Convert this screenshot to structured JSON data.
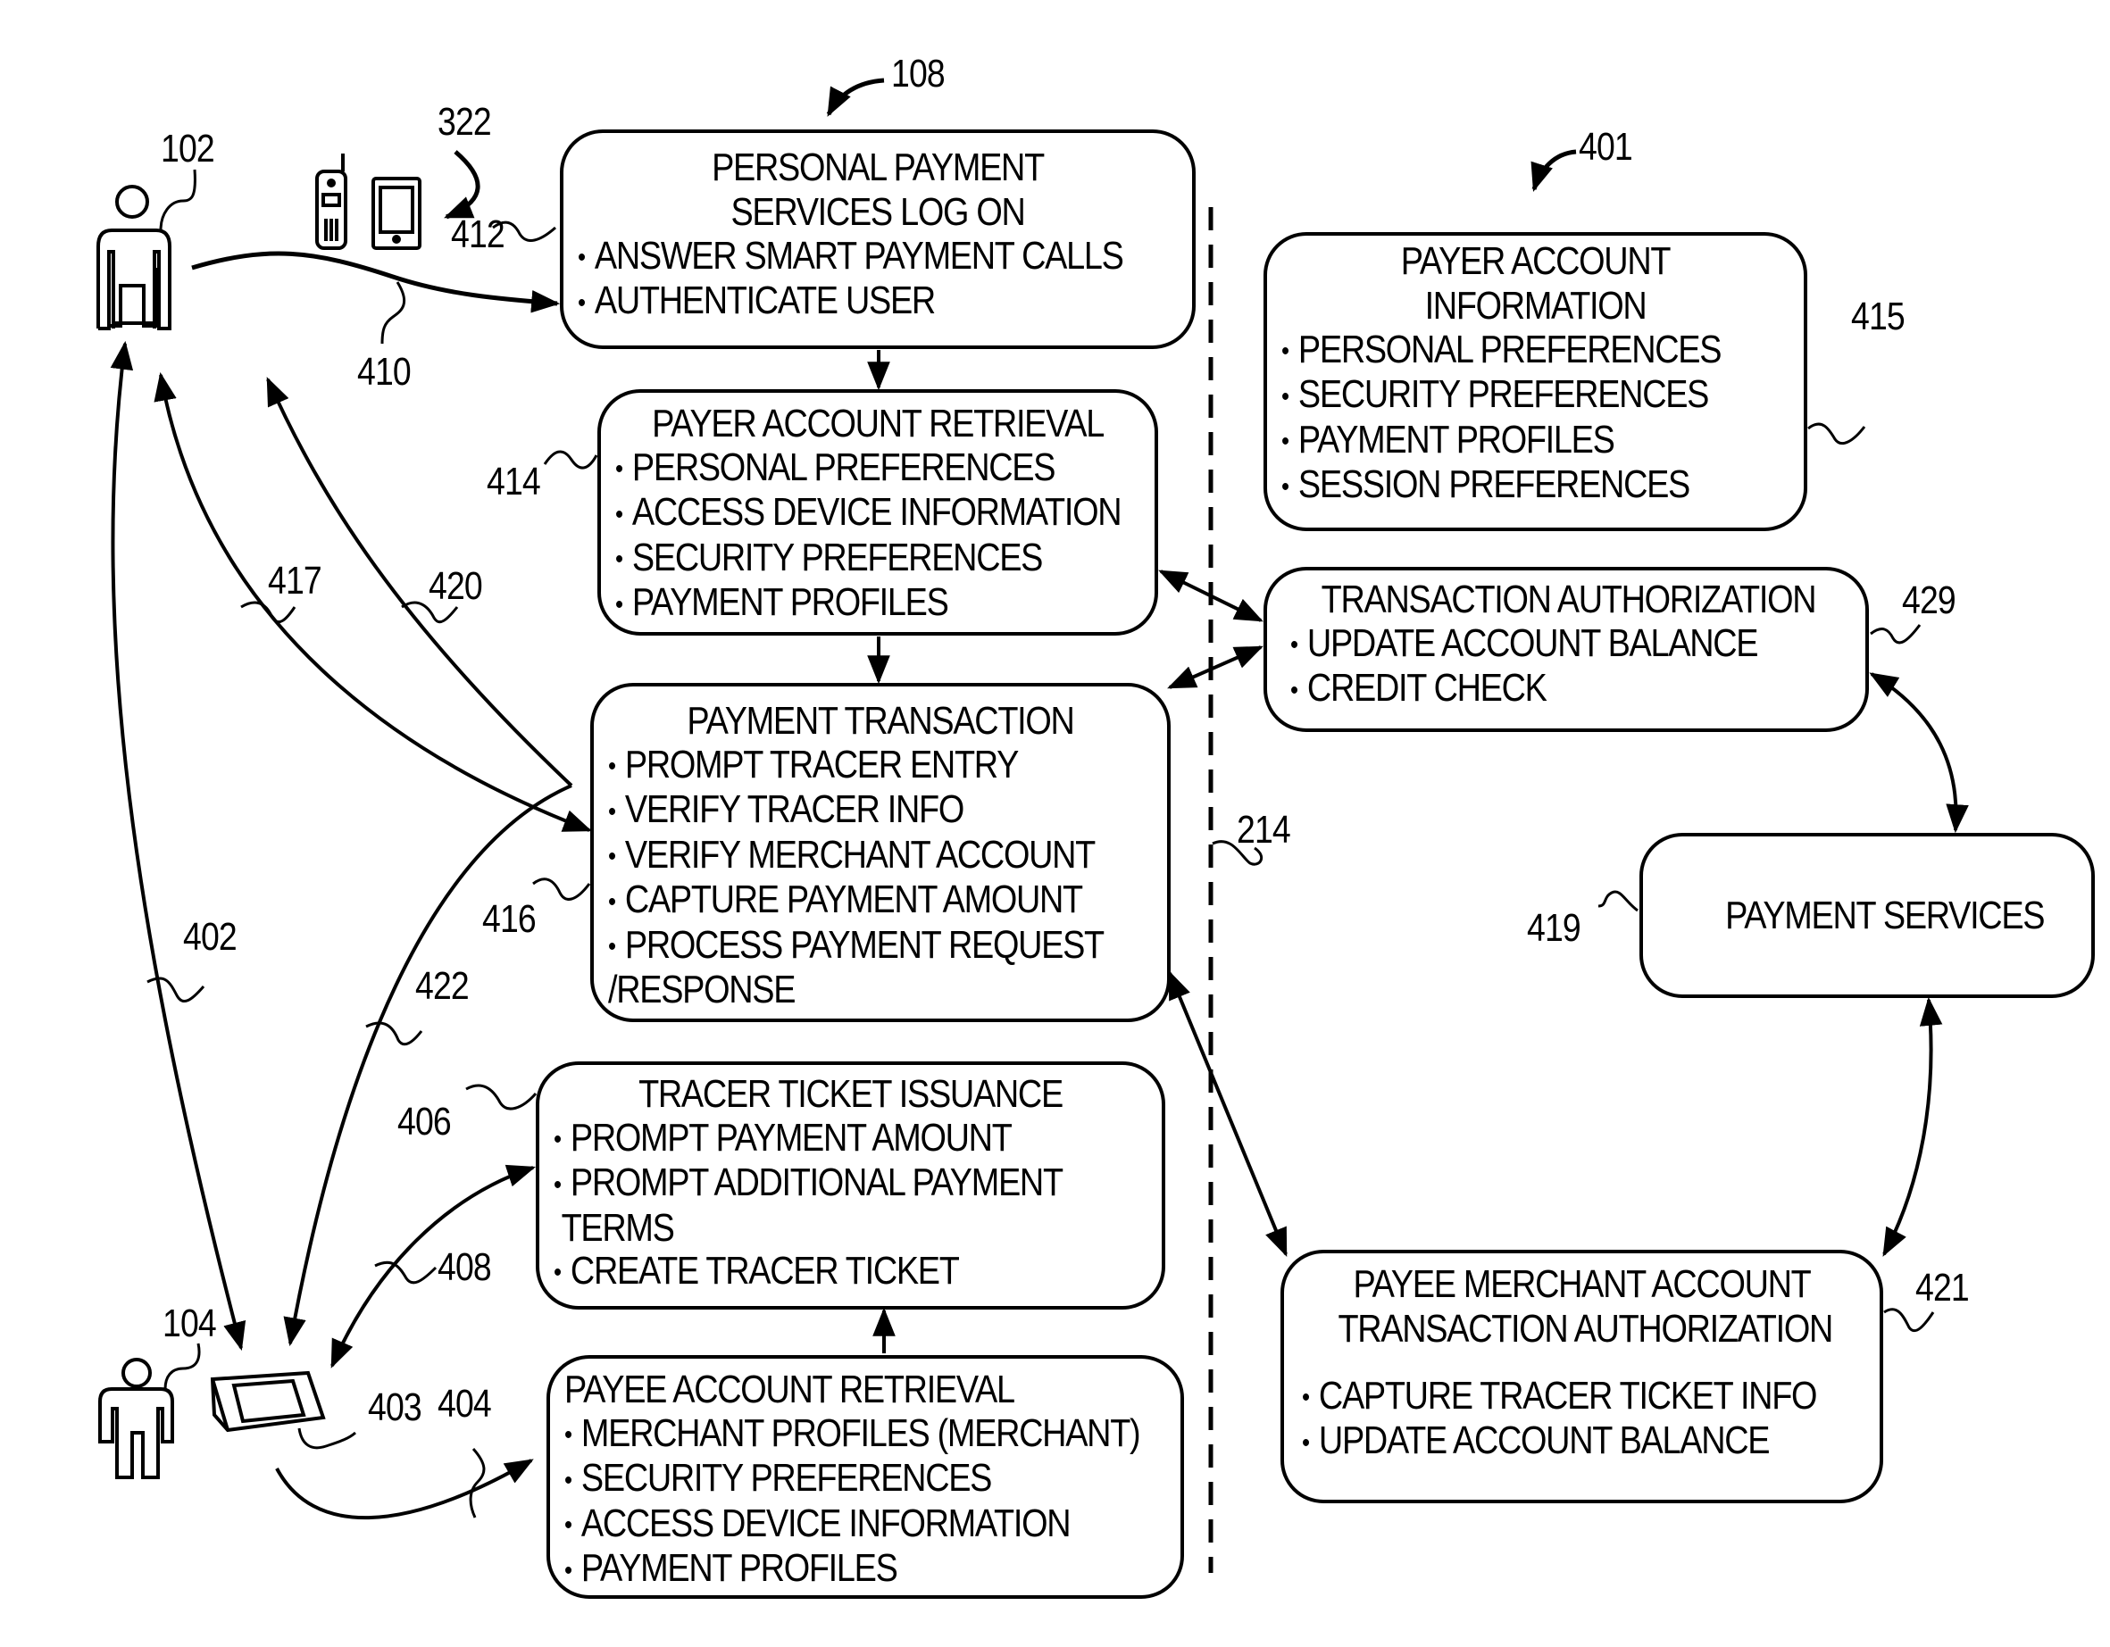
{
  "figure": {
    "references": {
      "system": "108",
      "network": "401",
      "payer_user": "102",
      "payee_user": "104",
      "payer_devices": "322",
      "payee_device": "403",
      "logon_box": "412",
      "payer_retrieval_box": "414",
      "payer_info_box": "415",
      "transaction_box": "416",
      "transaction_auth_box": "429",
      "payment_services_box": "419",
      "merchant_auth_box": "421",
      "tracer_box": "406",
      "payee_retrieval_box": "404",
      "flow_410": "410",
      "flow_417": "417",
      "flow_420": "420",
      "flow_402": "402",
      "flow_422": "422",
      "flow_408": "408",
      "boundary_214": "214"
    },
    "boxes": {
      "logon": {
        "title_lines": [
          "PERSONAL PAYMENT",
          "SERVICES LOG ON"
        ],
        "items": [
          "ANSWER SMART PAYMENT CALLS",
          "AUTHENTICATE USER"
        ]
      },
      "payer_retrieval": {
        "title": "PAYER ACCOUNT RETRIEVAL",
        "items": [
          "PERSONAL PREFERENCES",
          "ACCESS DEVICE INFORMATION",
          "SECURITY PREFERENCES",
          "PAYMENT PROFILES"
        ]
      },
      "transaction": {
        "title": "PAYMENT TRANSACTION",
        "items": [
          "PROMPT TRACER ENTRY",
          "VERIFY TRACER INFO",
          "VERIFY MERCHANT ACCOUNT",
          "CAPTURE PAYMENT AMOUNT",
          "PROCESS PAYMENT REQUEST"
        ],
        "continuation": "/RESPONSE"
      },
      "tracer": {
        "title": "TRACER TICKET ISSUANCE",
        "items": [
          "PROMPT PAYMENT AMOUNT",
          "PROMPT ADDITIONAL PAYMENT"
        ],
        "continuation": "TERMS",
        "last_item": "CREATE TRACER TICKET"
      },
      "payee_retrieval": {
        "title": "PAYEE ACCOUNT RETRIEVAL",
        "items": [
          "MERCHANT PROFILES (MERCHANT)",
          "SECURITY PREFERENCES",
          "ACCESS DEVICE INFORMATION",
          "PAYMENT PROFILES"
        ]
      },
      "payer_info": {
        "title_lines": [
          "PAYER ACCOUNT",
          "INFORMATION"
        ],
        "items": [
          "PERSONAL PREFERENCES",
          "SECURITY PREFERENCES",
          "PAYMENT PROFILES",
          "SESSION PREFERENCES"
        ]
      },
      "transaction_auth": {
        "title": "TRANSACTION AUTHORIZATION",
        "items": [
          "UPDATE ACCOUNT BALANCE",
          "CREDIT CHECK"
        ]
      },
      "payment_services": {
        "title": "PAYMENT SERVICES"
      },
      "merchant_auth": {
        "title_lines": [
          "PAYEE MERCHANT ACCOUNT",
          "TRANSACTION AUTHORIZATION"
        ],
        "items": [
          "CAPTURE TRACER TICKET INFO",
          "UPDATE ACCOUNT BALANCE"
        ]
      }
    },
    "bullet": "•"
  }
}
